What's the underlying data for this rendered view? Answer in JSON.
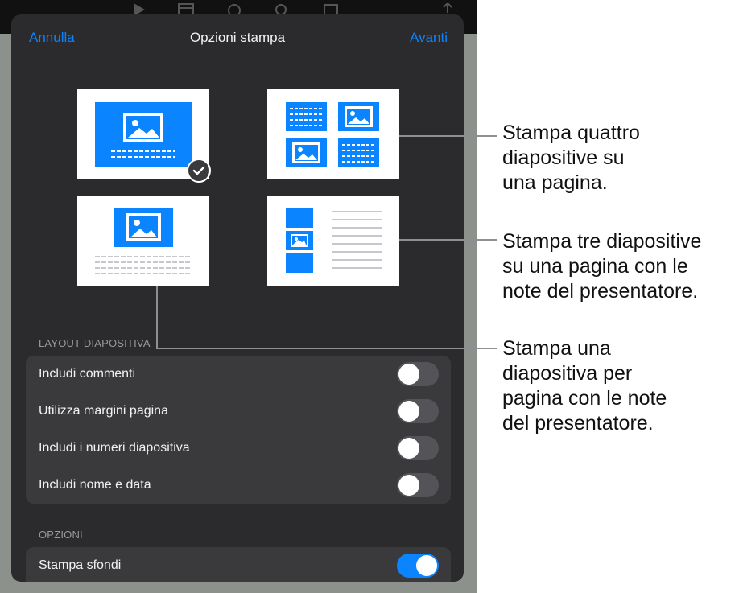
{
  "nav": {
    "cancel": "Annulla",
    "title": "Opzioni stampa",
    "next": "Avanti"
  },
  "sections": {
    "layout_title": "LAYOUT DIAPOSITIVA",
    "options_title": "OPZIONI"
  },
  "layout_options": [
    {
      "id": "one-slide",
      "selected": true
    },
    {
      "id": "four-slides",
      "selected": false
    },
    {
      "id": "one-slide-notes",
      "selected": false
    },
    {
      "id": "three-slides-notes",
      "selected": false
    }
  ],
  "toggles": [
    {
      "label": "Includi commenti",
      "on": false
    },
    {
      "label": "Utilizza margini pagina",
      "on": false
    },
    {
      "label": "Includi i numeri diapositiva",
      "on": false
    },
    {
      "label": "Includi nome e data",
      "on": false
    }
  ],
  "options": [
    {
      "label": "Stampa sfondi",
      "on": true
    }
  ],
  "callouts": [
    "Stampa quattro\ndiapositive su\nuna pagina.",
    "Stampa tre diapositive\nsu una pagina con le\nnote del presentatore.",
    "Stampa una\ndiapositiva per\npagina con le note\ndel presentatore."
  ],
  "colors": {
    "accent": "#0a84ff",
    "slide_blue": "#0a84ff",
    "sheet": "#2b2b2e",
    "group": "#3a3a3c"
  }
}
